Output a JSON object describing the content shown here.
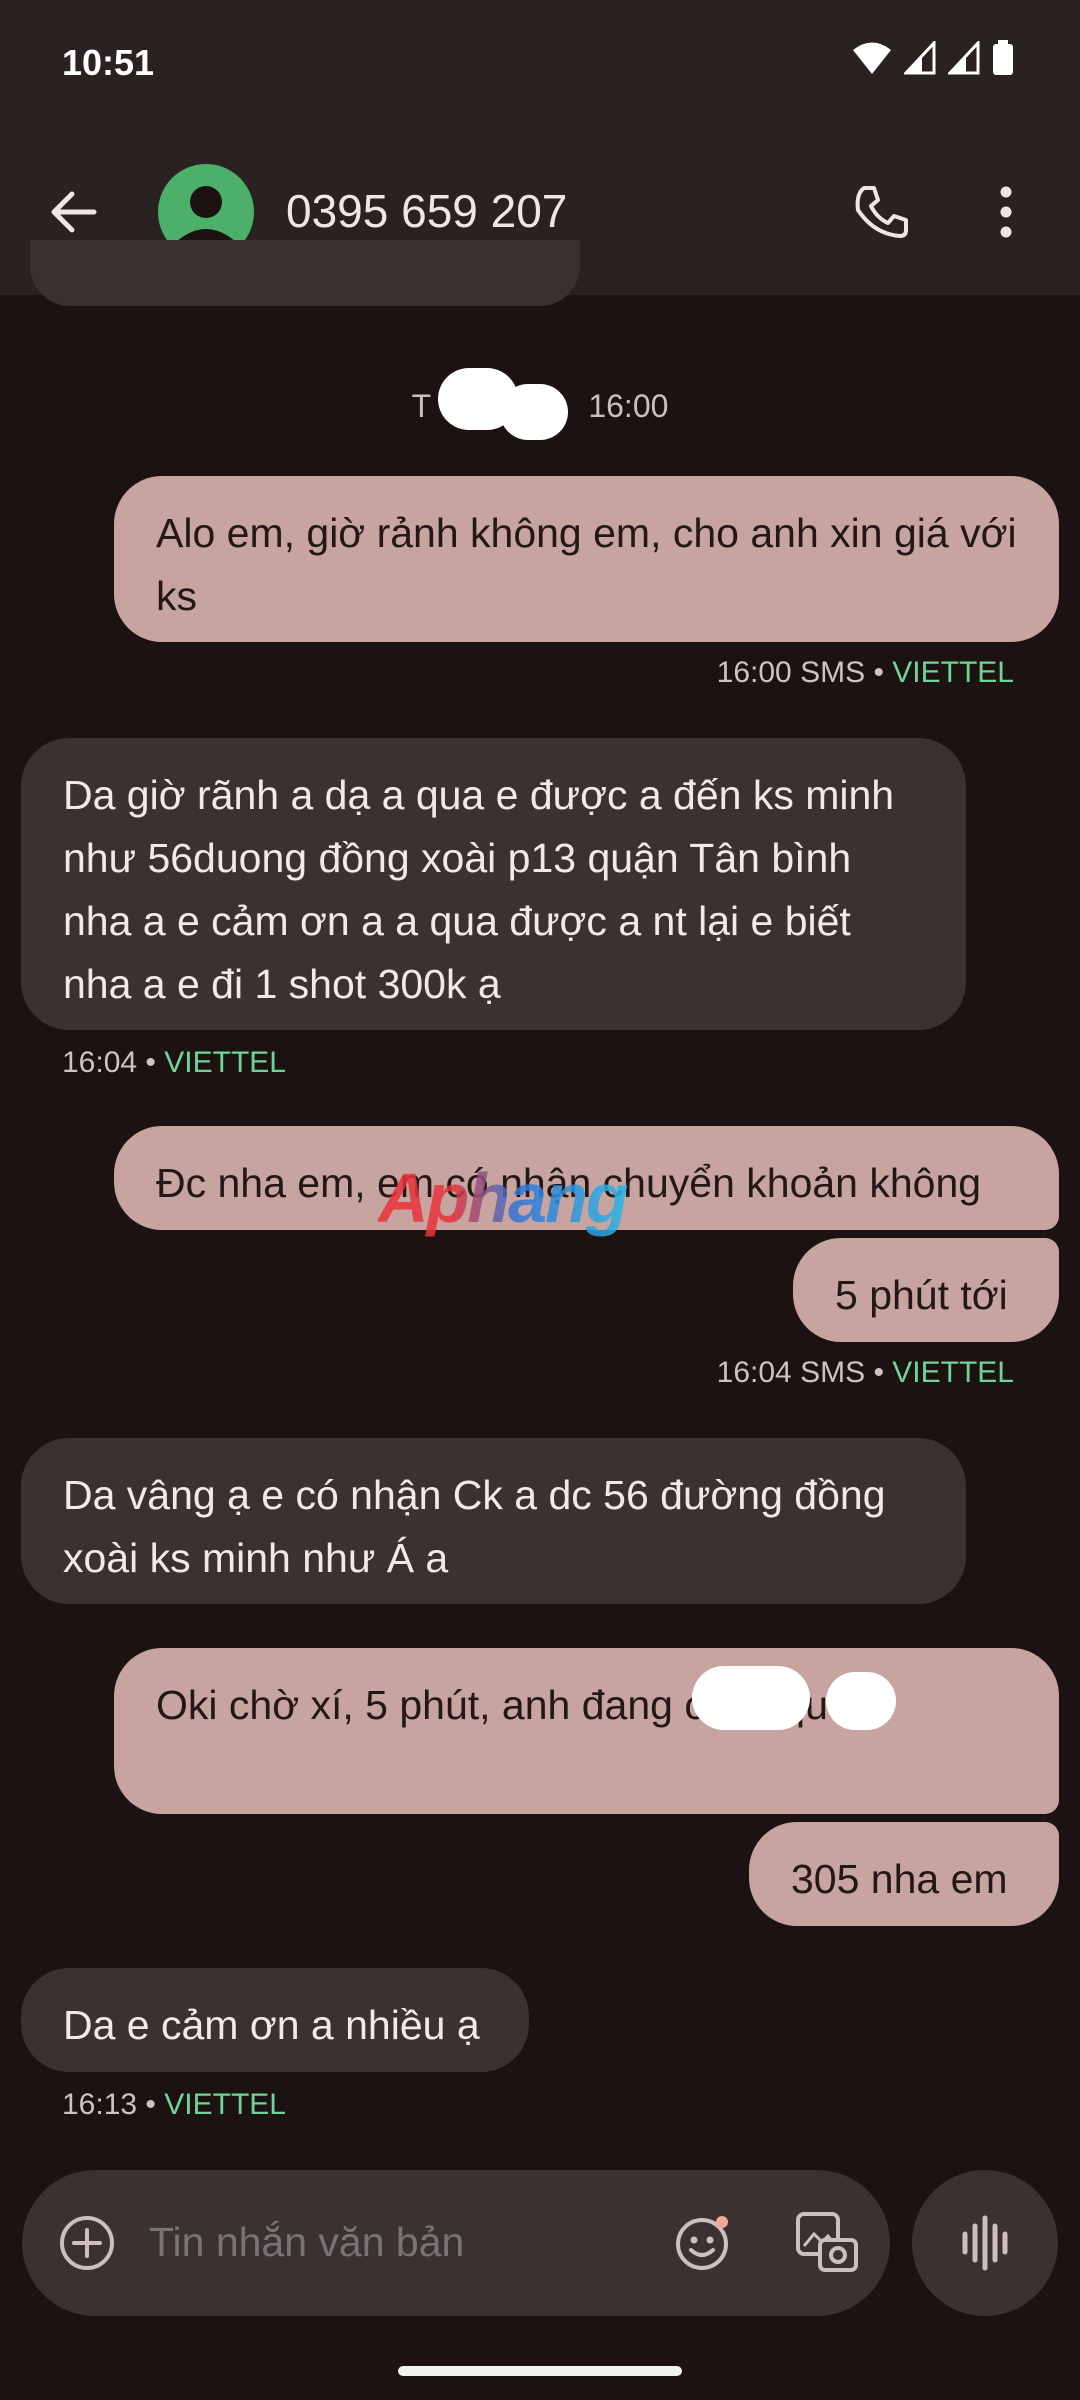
{
  "status": {
    "time": "10:51"
  },
  "header": {
    "contact": "0395 659 207"
  },
  "conversation": {
    "date_prefix": "T",
    "date_time": "16:00",
    "messages": [
      {
        "dir": "out",
        "text": "Alo em, giờ rảnh không em, cho anh xin giá với ks"
      },
      {
        "dir": "in",
        "text": "Da giờ rãnh a dạ a qua e được a đến ks minh như 56duong đồng xoài p13 quận Tân bình nha a e cảm ơn a a qua được a nt lại e biết nha a e đi 1 shot 300k ạ"
      },
      {
        "dir": "out",
        "text": "Đc nha em, em có nhận chuyển khoản không"
      },
      {
        "dir": "out",
        "text": "5 phút tới"
      },
      {
        "dir": "in",
        "text": "Da vâng ạ e có nhận Ck a dc 56 đường đồng xoài ks minh như Á a"
      },
      {
        "dir": "out",
        "text": "Oki chờ xí, 5 phút, anh đang chạy qua"
      },
      {
        "dir": "out",
        "text": "305 nha em"
      },
      {
        "dir": "in",
        "text": "Da e cảm ơn a nhiều ạ"
      }
    ],
    "meta": [
      {
        "time": "16:00",
        "type": "SMS",
        "sep": "•",
        "carrier": "VIETTEL"
      },
      {
        "time": "16:04",
        "type": "",
        "sep": "•",
        "carrier": "VIETTEL"
      },
      {
        "time": "16:04",
        "type": "SMS",
        "sep": "•",
        "carrier": "VIETTEL"
      },
      {
        "time": "16:13",
        "type": "",
        "sep": "•",
        "carrier": "VIETTEL"
      }
    ]
  },
  "watermark": "Aphang",
  "composer": {
    "placeholder": "Tin nhắn văn bản"
  },
  "icons": [
    "back-arrow-icon",
    "person-icon",
    "phone-icon",
    "more-vert-icon",
    "add-icon",
    "emoji-icon",
    "gallery-icon",
    "voice-icon",
    "wifi-icon",
    "signal-icon",
    "battery-icon"
  ]
}
